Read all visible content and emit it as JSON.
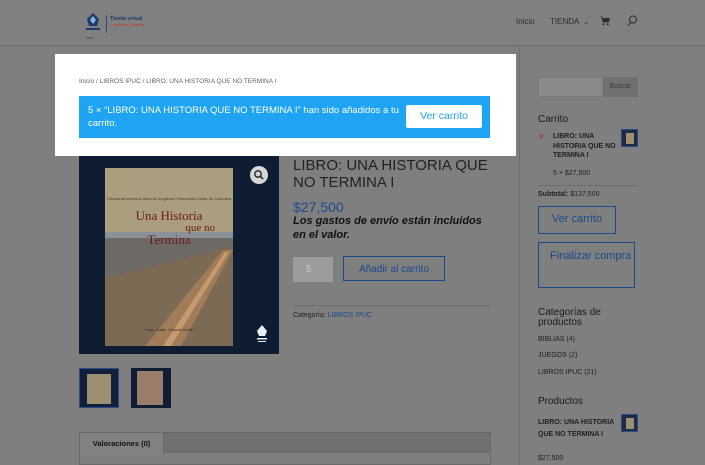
{
  "header": {
    "logo": {
      "line1": "Tienda virtual",
      "line2": "Fundación Editorial",
      "line3": "IPUC"
    },
    "nav": {
      "inicio": "Inicio",
      "tienda": "TIENDA",
      "tienda_caret": "⌄"
    },
    "icons": {
      "cart": "cart-icon",
      "search": "search-icon"
    }
  },
  "notice": {
    "breadcrumb": "Inicio / LIBROS IPUC / LIBRO: UNA HISTORIA QUE NO TERMINA I",
    "message": "5 × “LIBRO: UNA HISTORIA QUE NO TERMINA I” han sido añadidos a tu carrito.",
    "view_cart": "Ver carrito",
    "color": "#1ea4f2"
  },
  "product": {
    "cover": {
      "caption": "Cincuenta primeros años de la Iglesia Pentecostal Unida de Colombia",
      "title_line1": "Una Historia",
      "title_line2": "que no",
      "title_line3": "Termina",
      "bottom": "Hnos. Ovalle · Eduardo Ovalle"
    },
    "title": "LIBRO: UNA HISTORIA QUE NO TERMINA I",
    "price": "$27,500",
    "shipping_note": "Los gastos de envío están incluidos en el valor.",
    "quantity": "5",
    "add_to_cart": "Añadir al carrito",
    "category_label": "Categoría:",
    "category_value": "LIBROS IPUC",
    "tabs": [
      {
        "label": "Valoraciones (0)"
      }
    ]
  },
  "sidebar": {
    "search_button": "Buscar",
    "cart": {
      "heading": "Carrito",
      "remove": "×",
      "item_name": "LIBRO: UNA HISTORIA QUE NO TERMINA I",
      "item_qty": "5 × $27,500",
      "subtotal_label": "Subtotal:",
      "subtotal_value": "$137,500",
      "view_cart": "Ver carrito",
      "checkout": "Finalizar compra"
    },
    "categories": {
      "heading": "Categorías de productos",
      "items": [
        {
          "label": "BIBLIAS (4)"
        },
        {
          "label": "JUEGOS (2)"
        },
        {
          "label": "LIBROS IPUC (21)"
        }
      ]
    },
    "products": {
      "heading": "Productos",
      "item_name": "LIBRO: UNA HISTORIA QUE NO TERMINA I",
      "item_price": "$27,500"
    }
  }
}
